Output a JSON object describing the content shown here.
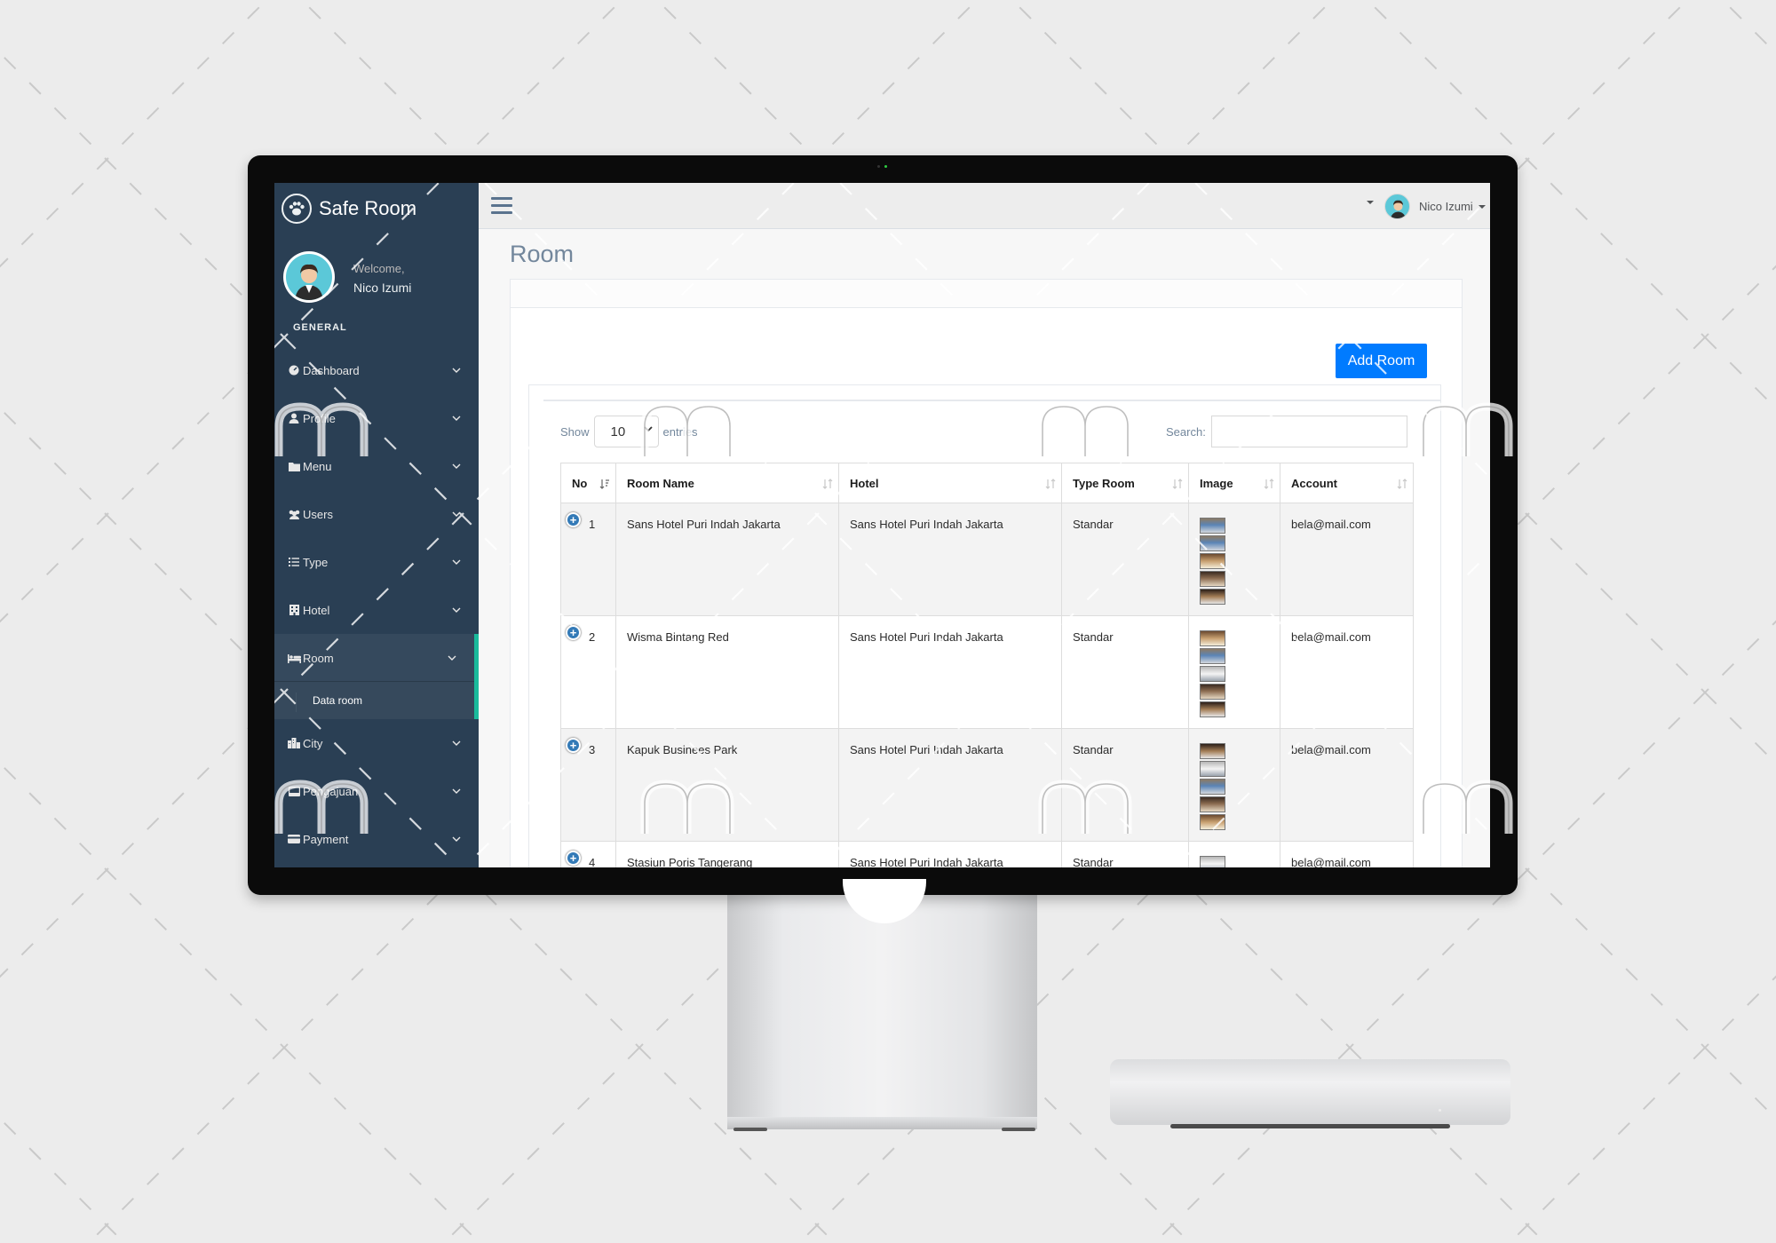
{
  "brand": {
    "name": "Safe Room",
    "icon": "paw-icon"
  },
  "user": {
    "welcome": "Welcome,",
    "name": "Nico Izumi"
  },
  "sidebar": {
    "section": "GENERAL",
    "items": [
      {
        "label": "Dashboard",
        "icon": "dashboard-icon"
      },
      {
        "label": "Profile",
        "icon": "user-icon"
      },
      {
        "label": "Menu",
        "icon": "folder-icon"
      },
      {
        "label": "Users",
        "icon": "users-icon"
      },
      {
        "label": "Type",
        "icon": "list-icon"
      },
      {
        "label": "Hotel",
        "icon": "building-icon"
      },
      {
        "label": "Room",
        "icon": "bed-icon",
        "active": true,
        "child": "Data room"
      },
      {
        "label": "City",
        "icon": "city-icon"
      },
      {
        "label": "Pengajuan",
        "icon": "drive-icon"
      },
      {
        "label": "Payment",
        "icon": "card-icon"
      }
    ]
  },
  "topbar": {
    "user_name": "Nico Izumi"
  },
  "page": {
    "title": "Room",
    "add_button": "Add Room"
  },
  "table_controls": {
    "show": "Show",
    "entries_value": "10",
    "entries": "entries",
    "search": "Search:"
  },
  "table": {
    "columns": [
      "No",
      "Room Name",
      "Hotel",
      "Type Room",
      "Image",
      "Account"
    ],
    "rows": [
      {
        "no": "1",
        "room": "Sans Hotel Puri Indah Jakarta",
        "hotel": "Sans Hotel Puri Indah Jakarta",
        "type": "Standar",
        "account": "bela@mail.com"
      },
      {
        "no": "2",
        "room": "Wisma Bintang Red",
        "hotel": "Sans Hotel Puri Indah Jakarta",
        "type": "Standar",
        "account": "bela@mail.com"
      },
      {
        "no": "3",
        "room": "Kapuk Businees Park",
        "hotel": "Sans Hotel Puri Indah Jakarta",
        "type": "Standar",
        "account": "bela@mail.com"
      },
      {
        "no": "4",
        "room": "Stasiun Poris Tangerang",
        "hotel": "Sans Hotel Puri Indah Jakarta",
        "type": "Standar",
        "account": "bela@mail.com"
      }
    ]
  },
  "colors": {
    "sidebar": "#2a3f54",
    "accent": "#1abb9c",
    "primary_button": "#007bff"
  }
}
